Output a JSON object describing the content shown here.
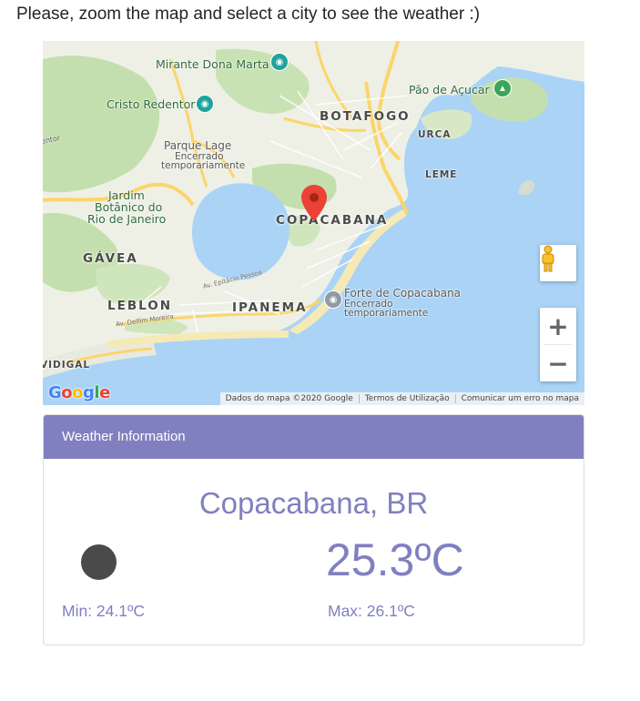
{
  "intro_text": "Please, zoom the map and select a city to see the weather :)",
  "map": {
    "labels": {
      "mirante": "Mirante Dona Marta",
      "cristo": "Cristo Redentor",
      "pao": "Pão de Açucar",
      "botafogo": "BOTAFOGO",
      "urca": "URCA",
      "parque_lage": "Parque Lage",
      "parque_lage_sub1": "Encerrado",
      "parque_lage_sub2": "temporariamente",
      "leme": "LEME",
      "jardim_1": "Jardim",
      "jardim_2": "Botânico do",
      "jardim_3": "Rio de Janeiro",
      "copacabana": "COPACABANA",
      "gavea": "GÁVEA",
      "leblon": "LEBLON",
      "ipanema": "IPANEMA",
      "forte": "Forte de Copacabana",
      "forte_sub1": "Encerrado",
      "forte_sub2": "temporariamente",
      "vidigal": "VIDIGAL",
      "entor": "entor",
      "epitacio": "Av. Epitácio Pessoa",
      "delfim": "Av. Delfim Moreira"
    },
    "google_logo": "Google",
    "attribution": {
      "data": "Dados do mapa ©2020 Google",
      "terms": "Termos de Utilização",
      "report": "Comunicar um erro no mapa"
    },
    "zoom_in": "+",
    "zoom_out": "−",
    "icons": {
      "pegman": "pegman-icon",
      "marker": "map-pin-icon",
      "camera": "camera-icon",
      "mountain": "mountain-icon"
    },
    "colors": {
      "water": "#aad3f6",
      "land": "#eef0e6",
      "park": "#c4dfae",
      "highway": "#fcd56a",
      "marker": "#ea4335"
    }
  },
  "weather": {
    "header": "Weather Information",
    "city": "Copacabana, BR",
    "temperature": "25.3ºC",
    "min": "Min: 24.1ºC",
    "max": "Max: 26.1ºC",
    "icon": "moon-icon",
    "accent_color": "#8080c0"
  }
}
